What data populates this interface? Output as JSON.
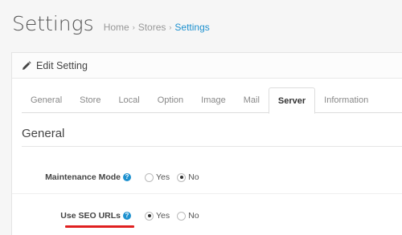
{
  "header": {
    "title": "Settings",
    "breadcrumb": [
      "Home",
      "Stores",
      "Settings"
    ]
  },
  "panel": {
    "heading": "Edit Setting"
  },
  "tabs": [
    {
      "label": "General",
      "active": false
    },
    {
      "label": "Store",
      "active": false
    },
    {
      "label": "Local",
      "active": false
    },
    {
      "label": "Option",
      "active": false
    },
    {
      "label": "Image",
      "active": false
    },
    {
      "label": "Mail",
      "active": false
    },
    {
      "label": "Server",
      "active": true
    },
    {
      "label": "Information",
      "active": false
    }
  ],
  "section": {
    "title": "General"
  },
  "fields": {
    "maintenance_mode": {
      "label": "Maintenance Mode",
      "options": [
        "Yes",
        "No"
      ],
      "selected": "No"
    },
    "use_seo_urls": {
      "label": "Use SEO URLs",
      "options": [
        "Yes",
        "No"
      ],
      "selected": "Yes"
    }
  },
  "help_glyph": "?",
  "colors": {
    "accent": "#1e91cf",
    "highlight": "#e02020"
  }
}
